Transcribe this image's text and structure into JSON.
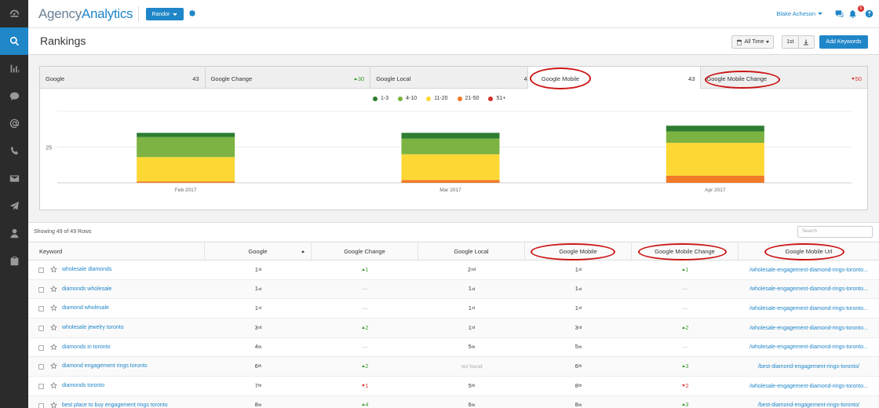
{
  "app": {
    "logo_part1": "Agency",
    "logo_part2": "Analytics",
    "client_label": "Randor",
    "user_name": "Blake Acheson",
    "notifications_count": "6"
  },
  "nav": [
    "dashboard-icon",
    "search-icon",
    "bar-chart-icon",
    "chat-icon",
    "at-sign-icon",
    "phone-icon",
    "envelope-icon",
    "send-icon",
    "user-icon",
    "clipboard-icon"
  ],
  "header": {
    "title": "Rankings",
    "date_range_label": "All Time",
    "first_btn_label": "1st",
    "add_keywords_label": "Add Keywords"
  },
  "tabs": [
    {
      "label": "Google",
      "value": "43",
      "dir": ""
    },
    {
      "label": "Google Change",
      "value": "30",
      "dir": "up"
    },
    {
      "label": "Google Local",
      "value": "4",
      "dir": ""
    },
    {
      "label": "Google Mobile",
      "value": "43",
      "dir": ""
    },
    {
      "label": "Google Mobile Change",
      "value": "50",
      "dir": "down"
    }
  ],
  "chart_data": {
    "type": "bar",
    "stacked": true,
    "categories": [
      "Feb 2017",
      "Mar 2017",
      "Apr 2017"
    ],
    "series": [
      {
        "name": "1-3",
        "color": "#2e7d32",
        "values": [
          3,
          4,
          4
        ]
      },
      {
        "name": "4-10",
        "color": "#7cb342",
        "values": [
          14,
          11,
          8
        ]
      },
      {
        "name": "11-20",
        "color": "#fdd835",
        "values": [
          17,
          18,
          23
        ]
      },
      {
        "name": "21-50",
        "color": "#ef7a27",
        "values": [
          0,
          0,
          0
        ]
      },
      {
        "name": "51+",
        "color": "#d32f2f",
        "values": [
          0,
          0,
          0
        ]
      }
    ],
    "extra_orange": [
      1,
      2,
      5
    ],
    "ylim": [
      0,
      50
    ],
    "yticks": [
      "25"
    ]
  },
  "table": {
    "rows_label": "Showing 49 of 49 Rows",
    "search_placeholder": "Search",
    "columns": [
      "Keyword",
      "Google",
      "Google Change",
      "Google Local",
      "Google Mobile",
      "Google Mobile Change",
      "Google Mobile Url"
    ],
    "rows": [
      {
        "keyword": "wholesale diamonds",
        "google": "1",
        "google_sup": "st",
        "gchange": "1",
        "gchange_dir": "up",
        "local": "2",
        "local_sup": "nd",
        "mobile": "1",
        "mobile_sup": "st",
        "mchange": "1",
        "mchange_dir": "up",
        "url": "/wholesale-engagement-diamond-rings-toronto..."
      },
      {
        "keyword": "diamonds wholesale",
        "google": "1",
        "google_sup": "st",
        "gchange": "—",
        "gchange_dir": "none",
        "local": "1",
        "local_sup": "st",
        "mobile": "1",
        "mobile_sup": "st",
        "mchange": "—",
        "mchange_dir": "none",
        "url": "/wholesale-engagement-diamond-rings-toronto..."
      },
      {
        "keyword": "diamond wholesale",
        "google": "1",
        "google_sup": "st",
        "gchange": "—",
        "gchange_dir": "none",
        "local": "1",
        "local_sup": "st",
        "mobile": "1",
        "mobile_sup": "st",
        "mchange": "—",
        "mchange_dir": "none",
        "url": "/wholesale-engagement-diamond-rings-toronto..."
      },
      {
        "keyword": "wholesale jewelry toronto",
        "google": "3",
        "google_sup": "rd",
        "gchange": "2",
        "gchange_dir": "up",
        "local": "1",
        "local_sup": "st",
        "mobile": "3",
        "mobile_sup": "rd",
        "mchange": "2",
        "mchange_dir": "up",
        "url": "/wholesale-engagement-diamond-rings-toronto..."
      },
      {
        "keyword": "diamonds in toronto",
        "google": "4",
        "google_sup": "th",
        "gchange": "—",
        "gchange_dir": "none",
        "local": "5",
        "local_sup": "th",
        "mobile": "5",
        "mobile_sup": "th",
        "mchange": "—",
        "mchange_dir": "none",
        "url": "/wholesale-engagement-diamond-rings-toronto..."
      },
      {
        "keyword": "diamond engagement rings toronto",
        "google": "6",
        "google_sup": "th",
        "gchange": "2",
        "gchange_dir": "up",
        "local": "not found",
        "local_sup": "",
        "mobile": "6",
        "mobile_sup": "th",
        "mchange": "3",
        "mchange_dir": "up",
        "url": "/best-diamond-engagement-rings-toronto/"
      },
      {
        "keyword": "diamonds toronto",
        "google": "7",
        "google_sup": "th",
        "gchange": "1",
        "gchange_dir": "down",
        "local": "5",
        "local_sup": "th",
        "mobile": "8",
        "mobile_sup": "th",
        "mchange": "2",
        "mchange_dir": "down",
        "url": "/wholesale-engagement-diamond-rings-toronto..."
      },
      {
        "keyword": "best place to buy engagement rings toronto",
        "google": "8",
        "google_sup": "th",
        "gchange": "4",
        "gchange_dir": "up",
        "local": "6",
        "local_sup": "th",
        "mobile": "8",
        "mobile_sup": "th",
        "mchange": "3",
        "mchange_dir": "up",
        "url": "/best-diamond-engagement-rings-toronto/"
      }
    ]
  }
}
